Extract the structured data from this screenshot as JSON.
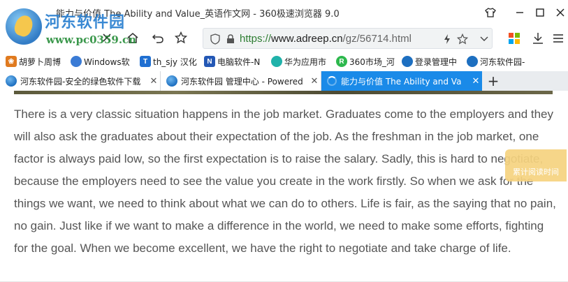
{
  "window": {
    "title": "能力与价值 The Ability and Value_英语作文网 - 360极速浏览器 9.0"
  },
  "watermark": {
    "line1": "河东软件园",
    "line2": "www.pc0359.cn"
  },
  "address": {
    "url_protocol": "https://",
    "url_host": "www.adreep.cn",
    "url_path": "/gz/56714.html"
  },
  "bookmarks": [
    {
      "label": "胡萝卜周博",
      "color": "#e07a1f",
      "icon": "bookmark-icon"
    },
    {
      "label": "Windows软",
      "color": "#3a7bd5",
      "icon": "bookmark-icon"
    },
    {
      "label": "th_sjy 汉化",
      "color": "#1f6fd1",
      "icon": "t-icon",
      "glyph": "T"
    },
    {
      "label": "电脑软件-N",
      "color": "#2458b5",
      "icon": "n-icon",
      "glyph": "N"
    },
    {
      "label": "华为应用市",
      "color": "#20b2aa",
      "icon": "huawei-icon"
    },
    {
      "label": "360市场_河",
      "color": "#2db84d",
      "icon": "r-icon",
      "glyph": "R"
    },
    {
      "label": "登录管理中",
      "color": "#1d6fc0",
      "icon": "site-icon"
    },
    {
      "label": "河东软件园-",
      "color": "#1d6fc0",
      "icon": "site-icon"
    }
  ],
  "tabs": [
    {
      "label": "河东软件园-安全的绿色软件下载"
    },
    {
      "label": "河东软件园 管理中心 - Powered"
    },
    {
      "label": "能力与价值 The Ability and Va"
    }
  ],
  "article": {
    "text": "There is a very classic situation happens in the job market. Graduates come to the employers and they will also ask the graduates about their expectation of the job. As the freshman in the job market, one factor is always paid low, so the first expectation is to raise the salary. Sadly, this is hard to negotiate, because the employers need to see the value you create in the work firstly. So when we ask for the things we want, we need to think about what we can do to others. Life is fair, as the saying that no pain, no gain. Just like if we want to make a difference in the world, we need to make some efforts, fighting for the goal. When we become excellent, we have the right to negotiate and take charge of life."
  },
  "reading_widget": {
    "label": "累计阅读时间"
  },
  "colors": {
    "active_tab": "#1a8ae8",
    "url_protocol": "#2e7d32",
    "article_text": "#555555"
  }
}
